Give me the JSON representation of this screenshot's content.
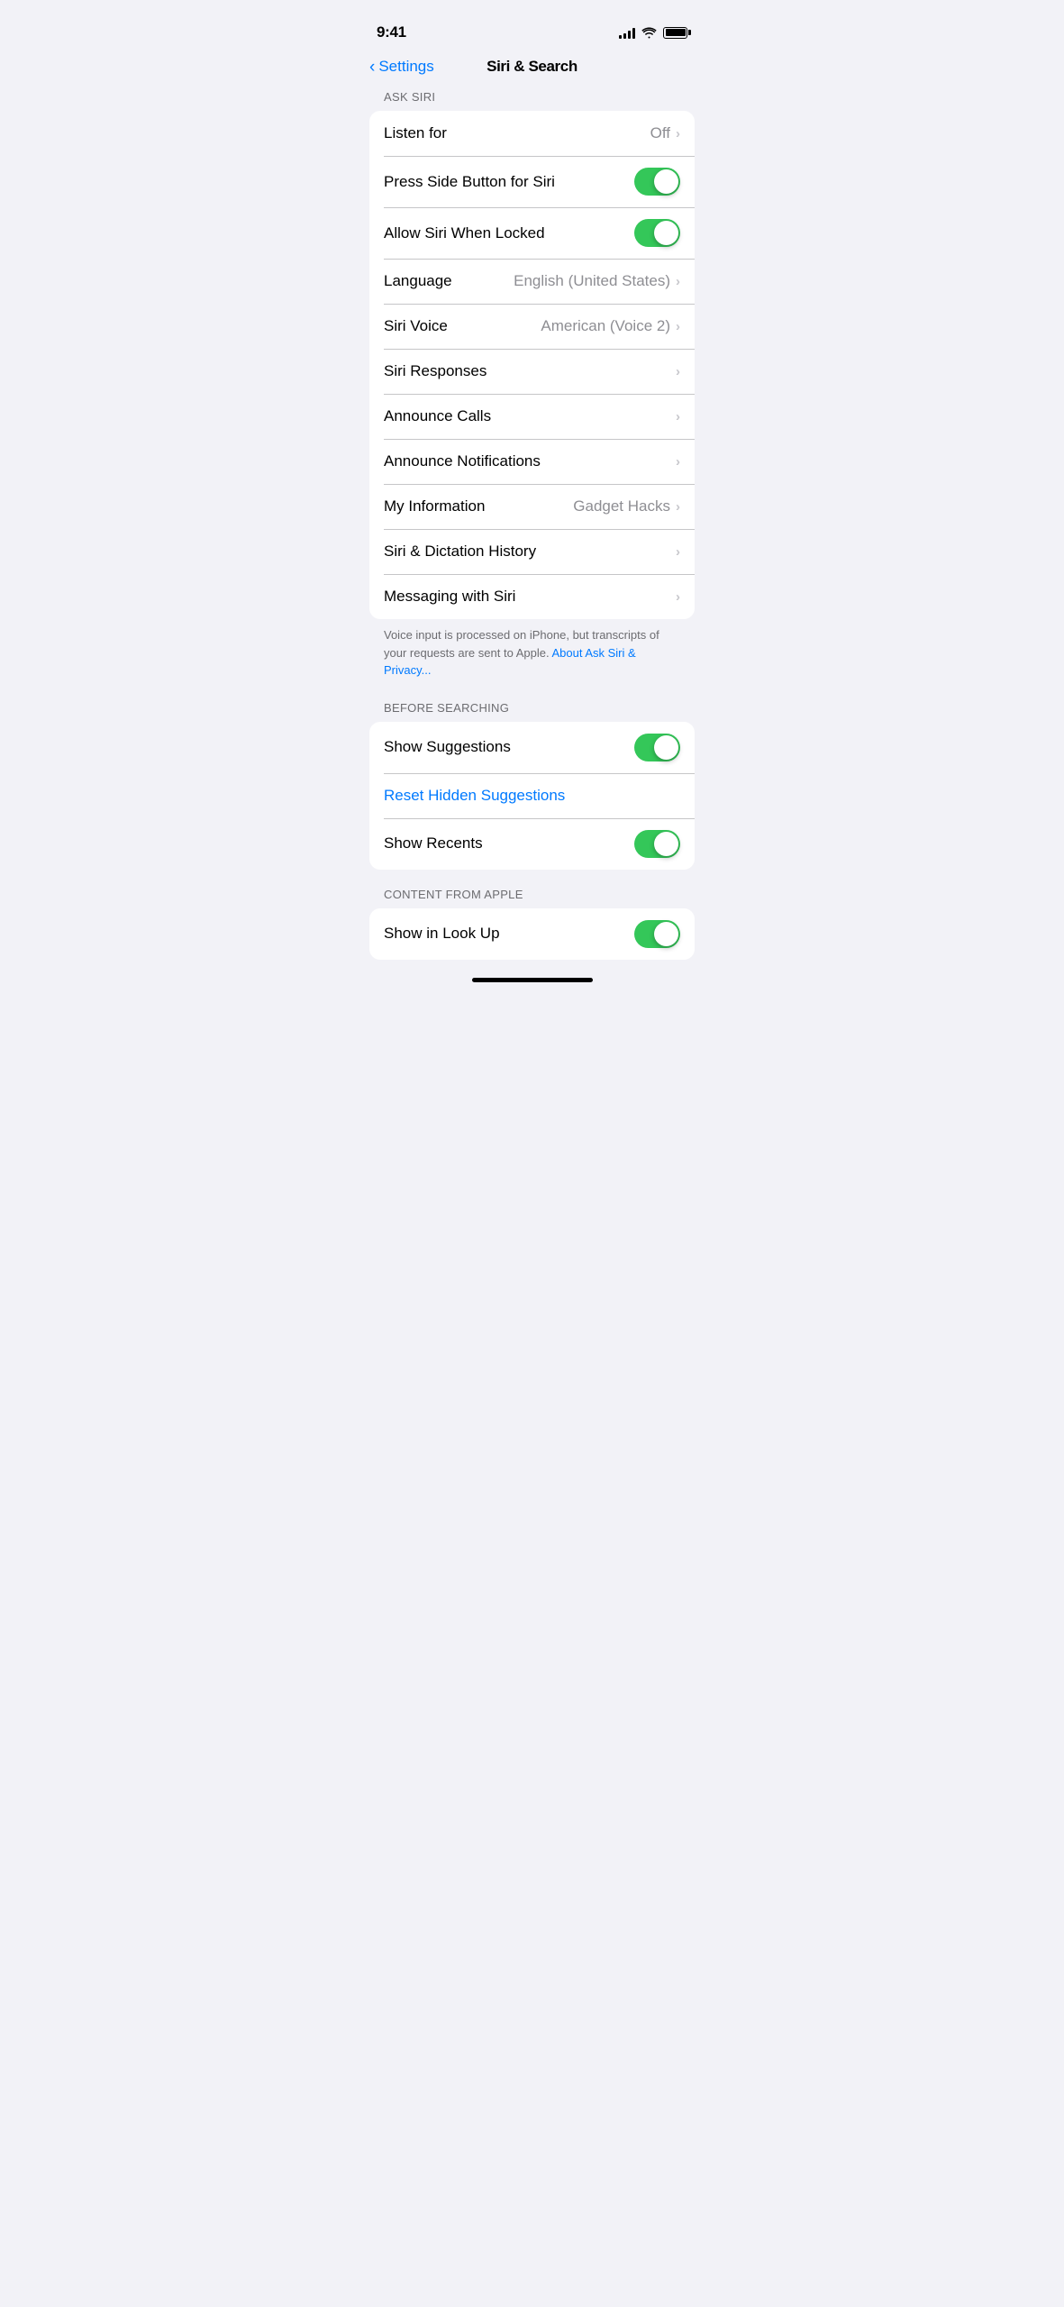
{
  "statusBar": {
    "time": "9:41"
  },
  "nav": {
    "back_label": "Settings",
    "title": "Siri & Search"
  },
  "sections": {
    "askSiri": {
      "header": "ASK SIRI",
      "items": [
        {
          "id": "listen-for",
          "label": "Listen for",
          "type": "value-chevron",
          "value": "Off"
        },
        {
          "id": "press-side-button",
          "label": "Press Side Button for Siri",
          "type": "toggle",
          "value": true
        },
        {
          "id": "allow-siri-locked",
          "label": "Allow Siri When Locked",
          "type": "toggle",
          "value": true
        },
        {
          "id": "language",
          "label": "Language",
          "type": "value-chevron",
          "value": "English (United States)"
        },
        {
          "id": "siri-voice",
          "label": "Siri Voice",
          "type": "value-chevron",
          "value": "American (Voice 2)"
        },
        {
          "id": "siri-responses",
          "label": "Siri Responses",
          "type": "chevron",
          "value": ""
        },
        {
          "id": "announce-calls",
          "label": "Announce Calls",
          "type": "chevron",
          "value": ""
        },
        {
          "id": "announce-notifications",
          "label": "Announce Notifications",
          "type": "chevron",
          "value": ""
        },
        {
          "id": "my-information",
          "label": "My Information",
          "type": "value-chevron",
          "value": "Gadget Hacks"
        },
        {
          "id": "siri-dictation-history",
          "label": "Siri & Dictation History",
          "type": "chevron",
          "value": ""
        },
        {
          "id": "messaging-with-siri",
          "label": "Messaging with Siri",
          "type": "chevron",
          "value": ""
        }
      ],
      "footer_text": "Voice input is processed on iPhone, but transcripts of your requests are sent to Apple. ",
      "footer_link": "About Ask Siri & Privacy..."
    },
    "beforeSearching": {
      "header": "BEFORE SEARCHING",
      "items": [
        {
          "id": "show-suggestions",
          "label": "Show Suggestions",
          "type": "toggle",
          "value": true
        },
        {
          "id": "reset-hidden-suggestions",
          "label": "Reset Hidden Suggestions",
          "type": "blue-link"
        },
        {
          "id": "show-recents",
          "label": "Show Recents",
          "type": "toggle",
          "value": true
        }
      ]
    },
    "contentFromApple": {
      "header": "CONTENT FROM APPLE",
      "items": [
        {
          "id": "show-in-look-up",
          "label": "Show in Look Up",
          "type": "toggle",
          "value": true
        }
      ]
    }
  }
}
